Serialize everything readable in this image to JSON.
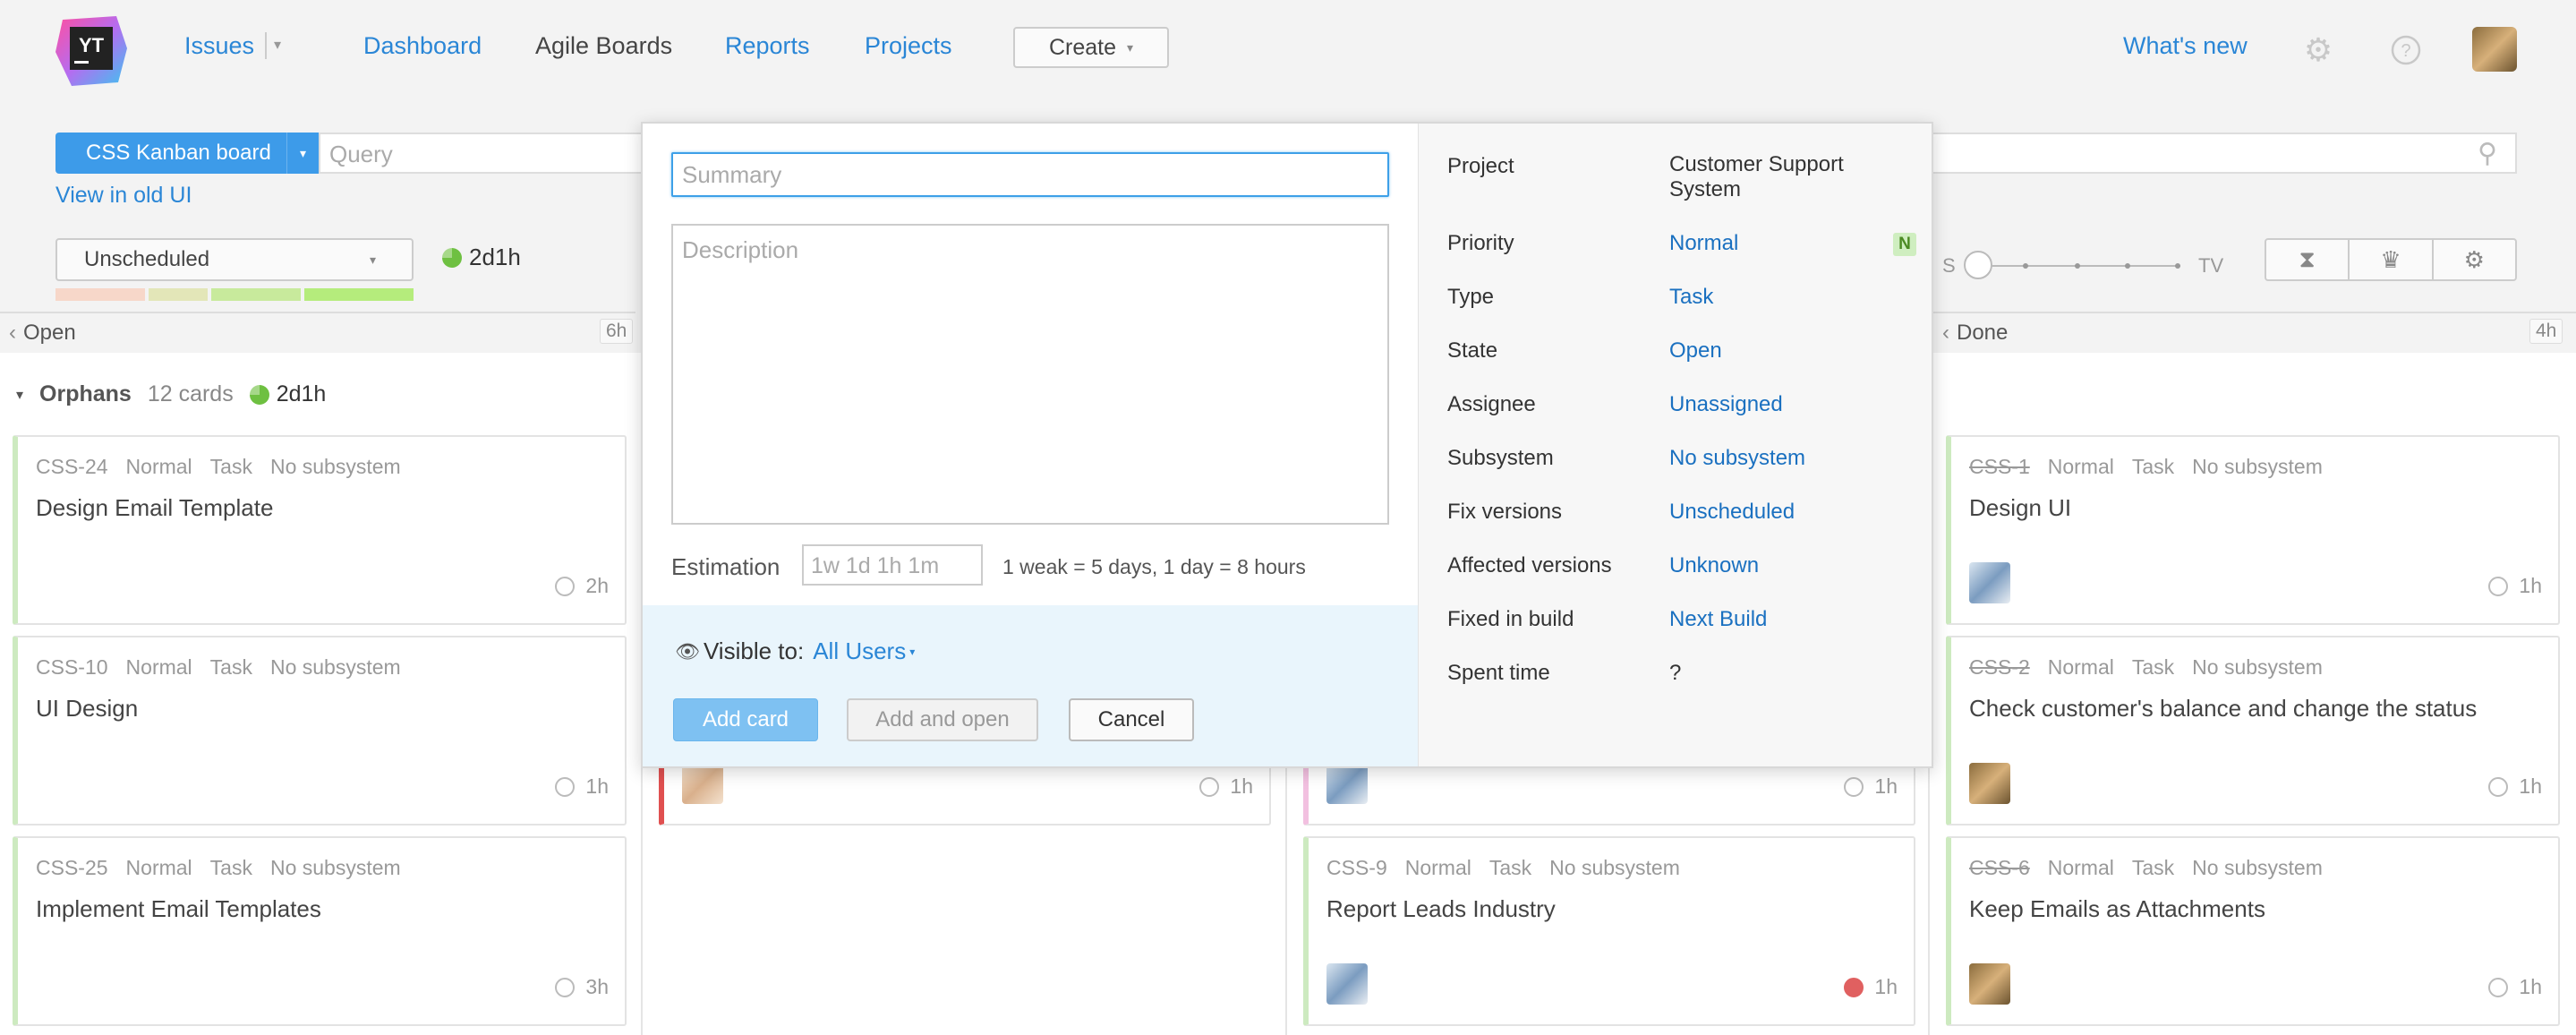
{
  "header": {
    "logo_text": "YT",
    "nav": [
      "Issues",
      "Dashboard",
      "Agile Boards",
      "Reports",
      "Projects"
    ],
    "create_label": "Create",
    "whats_new": "What's new"
  },
  "toolbar": {
    "board_name": "CSS Kanban board",
    "query_placeholder": "Query",
    "old_ui_link": "View in old UI",
    "sprint": "Unscheduled",
    "sprint_time": "2d1h",
    "slider_left": "S",
    "slider_right": "TV"
  },
  "columns": [
    {
      "name": "Open",
      "estimate": "6h"
    },
    {
      "name": "Done",
      "estimate": "4h"
    }
  ],
  "swimlane": {
    "name": "Orphans",
    "count": "12 cards",
    "time": "2d1h"
  },
  "cards": {
    "open": [
      {
        "id": "CSS-24",
        "priority": "Normal",
        "type": "Task",
        "subsystem": "No subsystem",
        "title": "Design Email Template",
        "estimate": "2h"
      },
      {
        "id": "CSS-10",
        "priority": "Normal",
        "type": "Task",
        "subsystem": "No subsystem",
        "title": "UI Design",
        "estimate": "1h"
      },
      {
        "id": "CSS-25",
        "priority": "Normal",
        "type": "Task",
        "subsystem": "No subsystem",
        "title": "Implement Email Templates",
        "estimate": "3h"
      }
    ],
    "middle": [
      {
        "estimate": "1h"
      }
    ],
    "third": [
      {
        "estimate": "1h"
      },
      {
        "id": "CSS-9",
        "priority": "Normal",
        "type": "Task",
        "subsystem": "No subsystem",
        "title": "Report Leads Industry",
        "estimate": "1h"
      }
    ],
    "done": [
      {
        "id": "CSS-1",
        "priority": "Normal",
        "type": "Task",
        "subsystem": "No subsystem",
        "title": "Design UI",
        "estimate": "1h"
      },
      {
        "id": "CSS-2",
        "priority": "Normal",
        "type": "Task",
        "subsystem": "No subsystem",
        "title": "Check customer's balance and change the status",
        "estimate": "1h"
      },
      {
        "id": "CSS-6",
        "priority": "Normal",
        "type": "Task",
        "subsystem": "No subsystem",
        "title": "Keep Emails as Attachments",
        "estimate": "1h"
      }
    ]
  },
  "dialog": {
    "summary_placeholder": "Summary",
    "description_placeholder": "Description",
    "estimation_label": "Estimation",
    "estimation_placeholder": "1w 1d 1h 1m",
    "estimation_hint": "1 weak = 5 days, 1 day = 8 hours",
    "visible_to_label": "Visible to:",
    "visible_to_value": "All Users",
    "add_card": "Add card",
    "add_and_open": "Add and open",
    "cancel": "Cancel",
    "fields": [
      {
        "label": "Project",
        "value": "Customer Support System"
      },
      {
        "label": "Priority",
        "value": "Normal",
        "badge": "N"
      },
      {
        "label": "Type",
        "value": "Task"
      },
      {
        "label": "State",
        "value": "Open"
      },
      {
        "label": "Assignee",
        "value": "Unassigned"
      },
      {
        "label": "Subsystem",
        "value": "No subsystem"
      },
      {
        "label": "Fix versions",
        "value": "Unscheduled"
      },
      {
        "label": "Affected versions",
        "value": "Unknown"
      },
      {
        "label": "Fixed in build",
        "value": "Next Build"
      },
      {
        "label": "Spent time",
        "value": "?"
      }
    ]
  },
  "colors": {
    "accent": "#2a86d6",
    "primary_button": "#3d9be9",
    "card_border_green": "#cdeac0",
    "card_border_red": "#e05050",
    "card_border_pink": "#f2c0e0"
  }
}
